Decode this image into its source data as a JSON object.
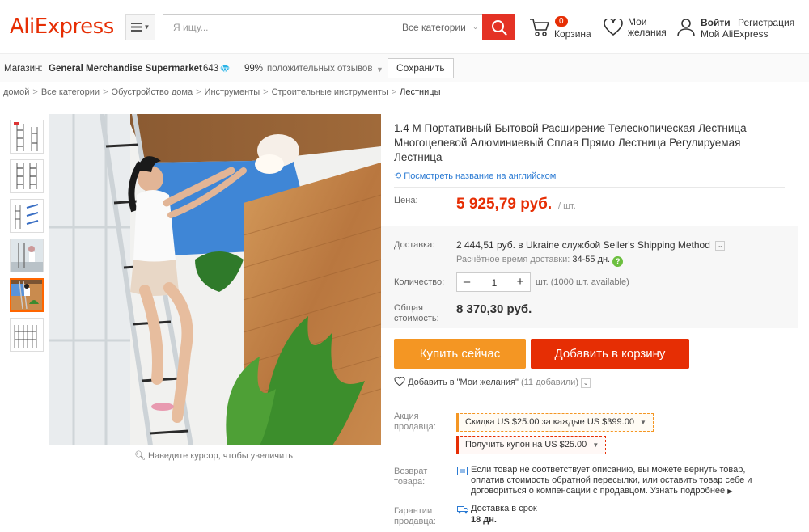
{
  "header": {
    "logo": "AliExpress",
    "search_placeholder": "Я ищу...",
    "category_select": "Все категории",
    "cart_count": "0",
    "cart_label": "Корзина",
    "wishlist_line1": "Мои",
    "wishlist_line2": "желания",
    "signin": "Войти",
    "register": "Регистрация",
    "my_account": "Мой AliExpress"
  },
  "store": {
    "label": "Магазин:",
    "name": "General Merchandise Supermarket",
    "score": "643",
    "percent": "99%",
    "feedback": "положительных отзывов",
    "save_button": "Сохранить"
  },
  "breadcrumb": [
    "домой",
    "Все категории",
    "Обустройство дома",
    "Инструменты",
    "Строительные инструменты",
    "Лестницы"
  ],
  "product": {
    "title": "1.4 М Портативный Бытовой Расширение Телескопическая Лестница Многоцелевой Алюминиевый Сплав Прямо Лестница Регулируемая Лестница",
    "translate_link": "Посмотреть название на английском",
    "price_label": "Цена:",
    "price": "5 925,79 руб.",
    "price_unit": "/ шт.",
    "shipping_label": "Доставка:",
    "shipping_value": "2 444,51 руб. в Ukraine службой Seller's Shipping Method",
    "shipping_est_label": "Расчётное время доставки:",
    "shipping_est_value": "34-55 дн.",
    "qty_label": "Количество:",
    "qty_value": "1",
    "qty_note": "шт. (1000 шт. available)",
    "total_label_line1": "Общая",
    "total_label_line2": "стоимость:",
    "total": "8 370,30 руб.",
    "buy_now": "Купить сейчас",
    "add_to_cart": "Добавить в корзину",
    "wishlist_add": "Добавить в \"Мои желания\"",
    "wishlist_count": "(11 добавили)",
    "promo_label_line1": "Акция",
    "promo_label_line2": "продавца:",
    "promo_discount": "Скидка US $25.00 за каждые US $399.00",
    "promo_coupon": "Получить купон на US $25.00",
    "return_label_line1": "Возврат",
    "return_label_line2": "товара:",
    "return_text": "Если товар не соответствует описанию, вы можете вернуть товар, оплатив стоимость обратной пересылки, или оставить товар себе и договориться о компенсации с продавцом.",
    "return_more": "Узнать подробнее",
    "guarantee_label_line1": "Гарантии",
    "guarantee_label_line2": "продавца:",
    "guarantee_line1": "Доставка в срок",
    "guarantee_line2": "18 дн.",
    "zoom_hint": "Наведите курсор, чтобы увеличить"
  },
  "colors": {
    "brand_red": "#e62e04",
    "buy_orange": "#f49623",
    "link_blue": "#2a7ad3"
  }
}
